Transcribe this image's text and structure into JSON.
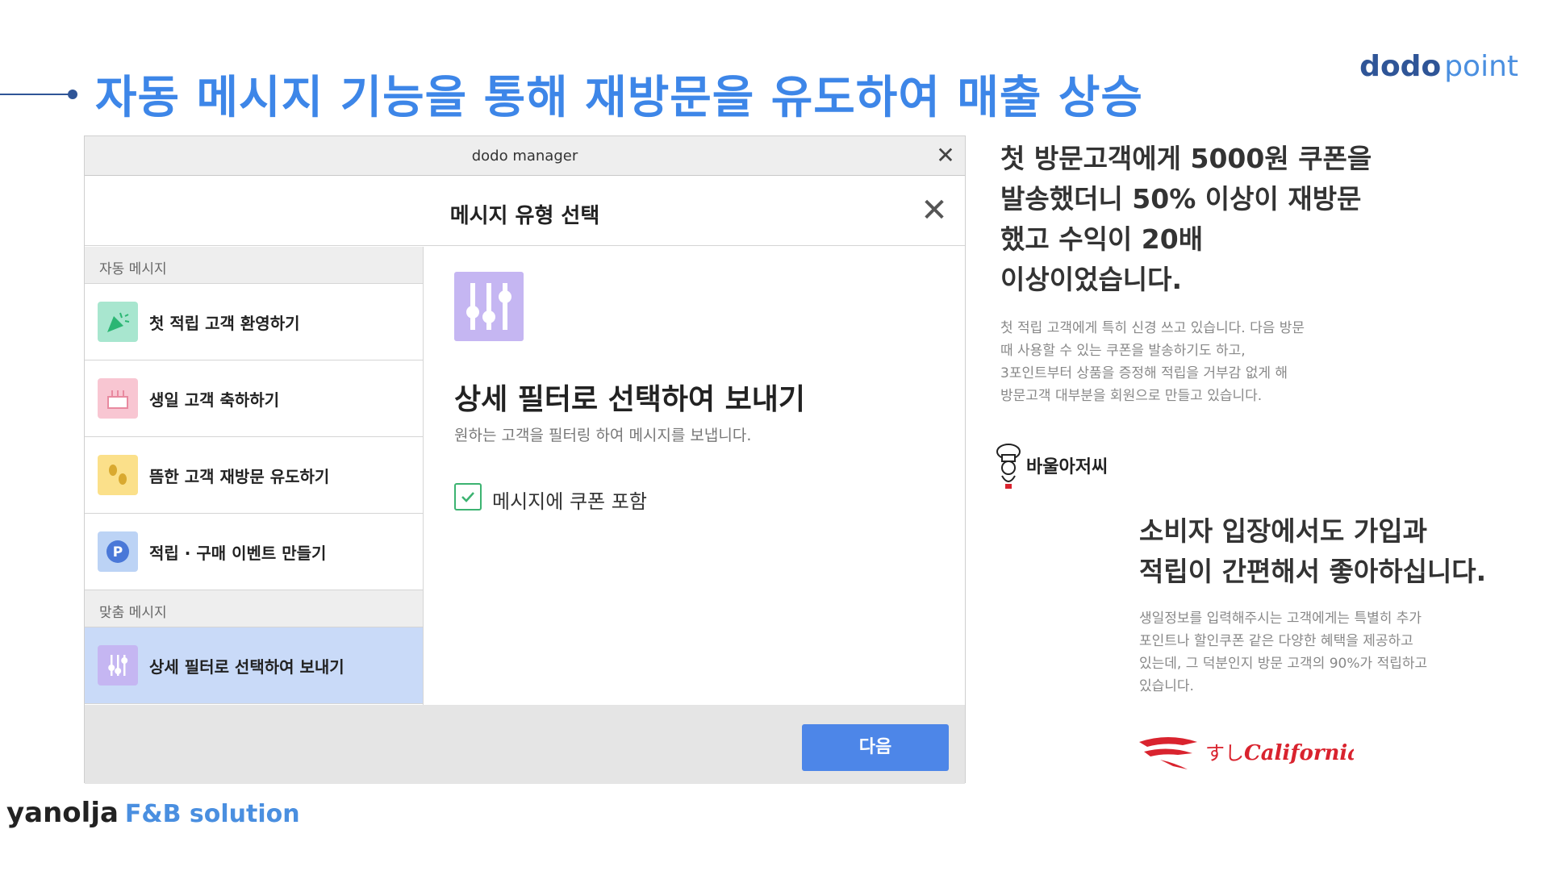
{
  "headline": "자동 메시지 기능을 통해 재방문을 유도하여 매출 상승",
  "brand": {
    "part1": "dodo",
    "part2": "point"
  },
  "window": {
    "title": "dodo manager",
    "dialog_title": "메시지 유형 선택",
    "sidebar": {
      "section_auto": "자동 메시지",
      "items_auto": [
        {
          "label": "첫 적립 고객 환영하기",
          "icon": "party-popper-icon"
        },
        {
          "label": "생일 고객 축하하기",
          "icon": "birthday-cake-icon"
        },
        {
          "label": "뜸한 고객 재방문 유도하기",
          "icon": "footprints-icon"
        },
        {
          "label": "적립 · 구매 이벤트 만들기",
          "icon": "point-p-icon"
        }
      ],
      "section_custom": "맞춤 메시지",
      "items_custom": [
        {
          "label": "상세 필터로 선택하여 보내기",
          "icon": "sliders-icon"
        }
      ]
    },
    "content": {
      "title": "상세 필터로 선택하여 보내기",
      "subtitle": "원하는 고객을 필터링 하여 메시지를 보냅니다.",
      "checkbox_label": "메시지에 쿠폰 포함",
      "checkbox_checked": true
    },
    "next_button": "다음"
  },
  "right": {
    "quote1_lines": [
      "첫 방문고객에게 5000원 쿠폰을",
      "발송했더니 50% 이상이 재방문",
      "했고 수익이 20배",
      "이상이었습니다."
    ],
    "desc1_lines": [
      "첫 적립 고객에게 특히 신경 쓰고 있습니다. 다음 방문",
      "때 사용할 수 있는 쿠폰을 발송하기도 하고,",
      "3포인트부터 상품을 증정해 적립을 거부감 없게 해",
      "방문고객 대부분을 회원으로 만들고 있습니다."
    ],
    "logo1_text": "바울아저씨",
    "quote2_lines": [
      "소비자 입장에서도 가입과",
      "적립이 간편해서 좋아하십니다."
    ],
    "desc2_lines": [
      "생일정보를 입력해주시는 고객에게는 특별히 추가",
      "포인트나 할인쿠폰 같은 다양한 혜택을 제공하고",
      "있는데, 그 덕분인지 방문 고객의 90%가 적립하고",
      "있습니다."
    ],
    "logo2_text_a": "すし",
    "logo2_text_b": "California"
  },
  "footer_brand": {
    "part1": "yanolja",
    "part2": "F&B solution"
  },
  "colors": {
    "headline": "#3d86e8",
    "accent": "#4d86e8",
    "selected": "#c9daf8",
    "check": "#3cb371"
  }
}
